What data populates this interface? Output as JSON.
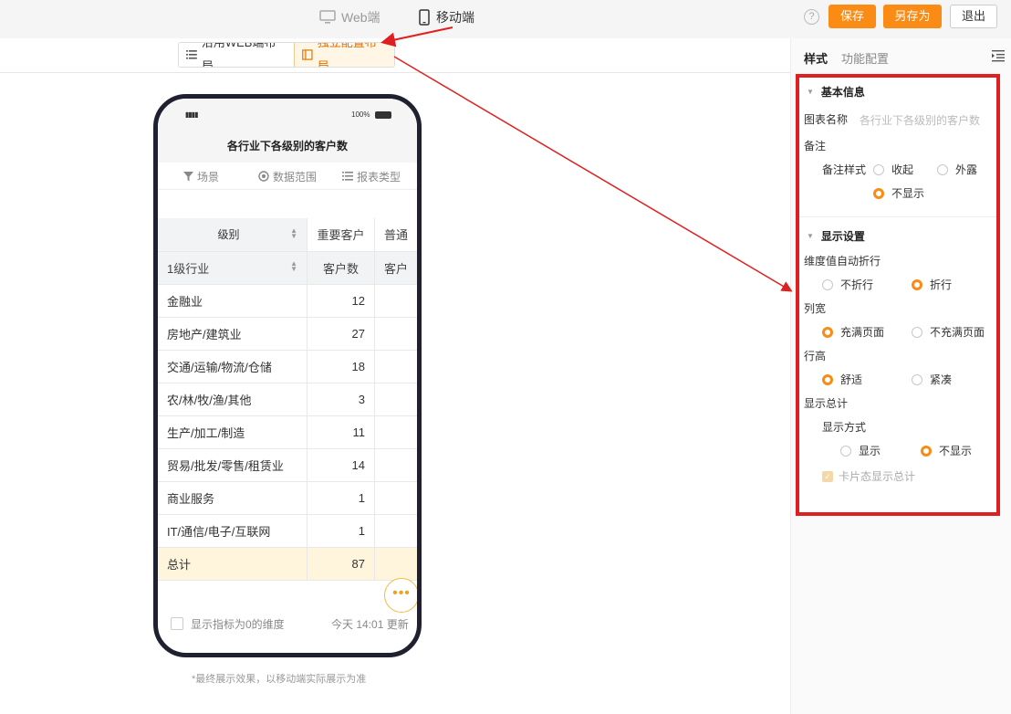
{
  "topbar": {
    "web_label": "Web端",
    "mobile_label": "移动端",
    "help_glyph": "?",
    "save": "保存",
    "save_as": "另存为",
    "exit": "退出"
  },
  "layout": {
    "web_layout": "沿用WEB端布局",
    "independent_layout": "独立配置布局"
  },
  "phone": {
    "battery": "100%",
    "title": "各行业下各级别的客户数",
    "tabs": [
      "场景",
      "数据范围",
      "报表类型"
    ],
    "table": {
      "header1": [
        "级别",
        "重要客户",
        "普通"
      ],
      "header2": [
        "1级行业",
        "客户数",
        "客户"
      ],
      "rows": [
        {
          "name": "金融业",
          "value": "12"
        },
        {
          "name": "房地产/建筑业",
          "value": "27"
        },
        {
          "name": "交通/运输/物流/仓储",
          "value": "18"
        },
        {
          "name": "农/林/牧/渔/其他",
          "value": "3"
        },
        {
          "name": "生产/加工/制造",
          "value": "11"
        },
        {
          "name": "贸易/批发/零售/租赁业",
          "value": "14"
        },
        {
          "name": "商业服务",
          "value": "1"
        },
        {
          "name": "IT/通信/电子/互联网",
          "value": "1"
        }
      ],
      "total": {
        "name": "总计",
        "value": "87"
      }
    },
    "footer_checkbox": "显示指标为0的维度",
    "footer_update": "今天 14:01 更新"
  },
  "disclaimer": "*最终展示效果，以移动端实际展示为准",
  "panel": {
    "tab_style": "样式",
    "tab_function": "功能配置",
    "basic": {
      "title": "基本信息",
      "chart_name_label": "图表名称",
      "chart_name_placeholder": "各行业下各级别的客户数",
      "note_label": "备注",
      "note_style_label": "备注样式",
      "note_options": [
        "收起",
        "外露",
        "不显示"
      ]
    },
    "display": {
      "title": "显示设置",
      "wrap_label": "维度值自动折行",
      "wrap_options": [
        "不折行",
        "折行"
      ],
      "col_width_label": "列宽",
      "col_width_options": [
        "充满页面",
        "不充满页面"
      ],
      "row_height_label": "行高",
      "row_height_options": [
        "舒适",
        "紧凑"
      ],
      "total_label": "显示总计",
      "total_mode_label": "显示方式",
      "total_mode_options": [
        "显示",
        "不显示"
      ],
      "card_total": "卡片态显示总计"
    }
  },
  "colors": {
    "accent": "#fa8c16",
    "highlight_box": "#e02020",
    "total_row": "#fff4dc"
  }
}
